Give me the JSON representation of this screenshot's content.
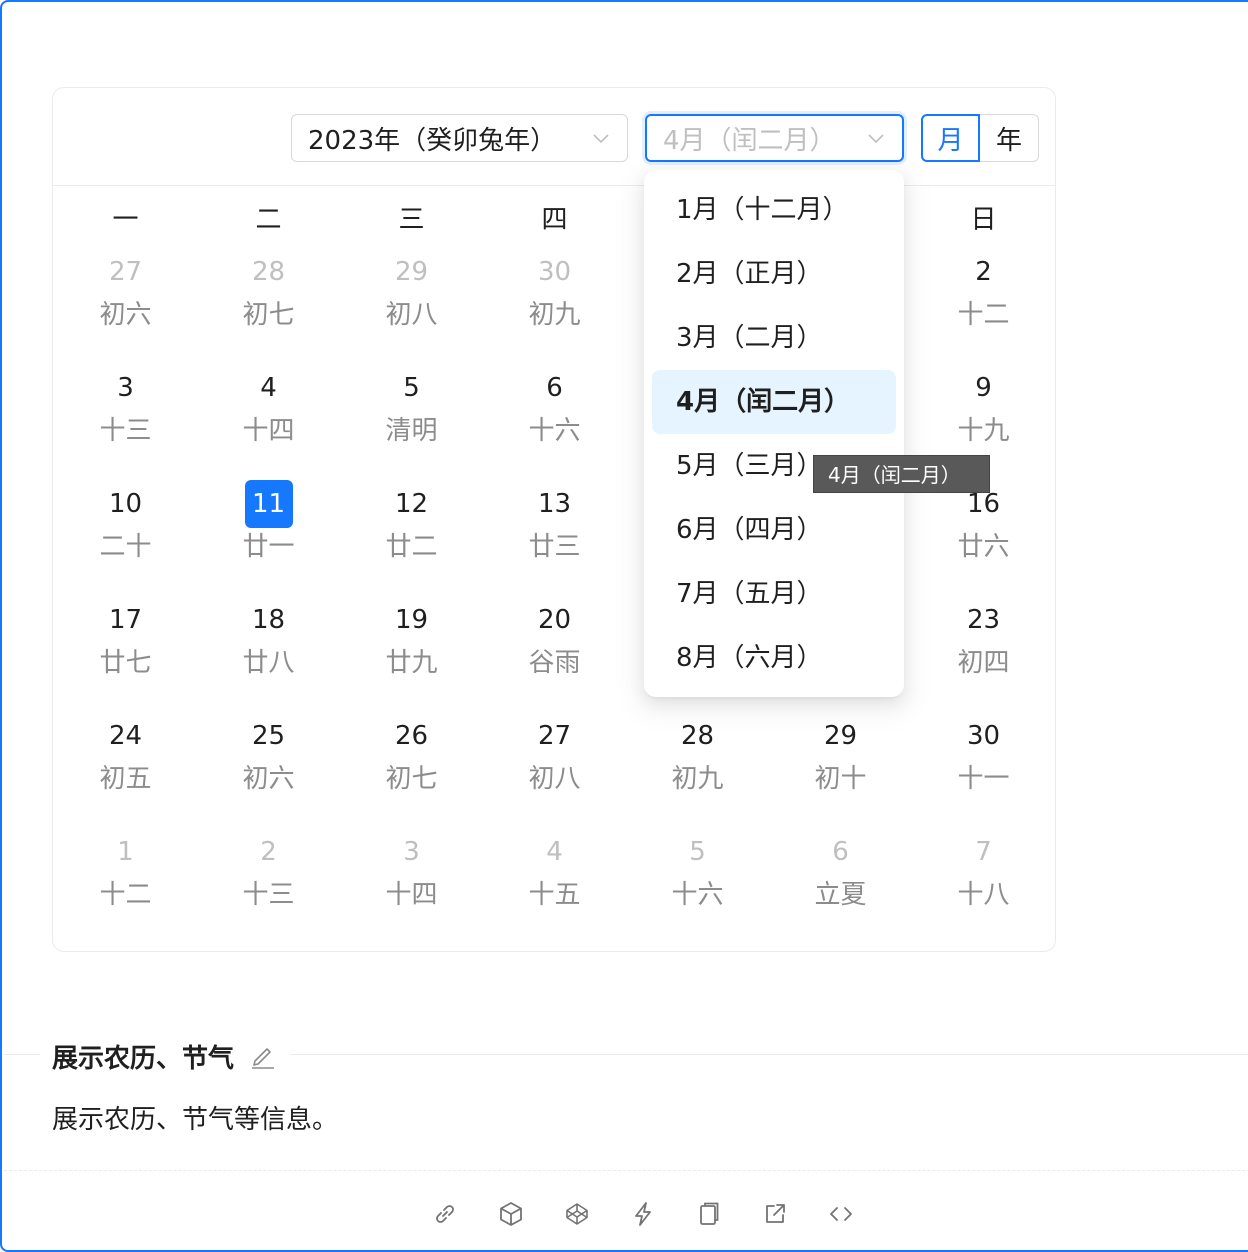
{
  "header": {
    "year_value": "2023年（癸卯兔年）",
    "month_value": "4月（闰二月）",
    "mode_month": "月",
    "mode_year": "年"
  },
  "weekdays": [
    "一",
    "二",
    "三",
    "四",
    "",
    "",
    "日"
  ],
  "days": [
    [
      {
        "n": "27",
        "l": "初六",
        "o": true
      },
      {
        "n": "28",
        "l": "初七",
        "o": true
      },
      {
        "n": "29",
        "l": "初八",
        "o": true
      },
      {
        "n": "30",
        "l": "初九",
        "o": true
      },
      {
        "n": "",
        "l": "",
        "o": true
      },
      {
        "n": "",
        "l": "",
        "o": true
      },
      {
        "n": "2",
        "l": "十二",
        "o": false
      }
    ],
    [
      {
        "n": "3",
        "l": "十三",
        "o": false
      },
      {
        "n": "4",
        "l": "十四",
        "o": false
      },
      {
        "n": "5",
        "l": "清明",
        "o": false
      },
      {
        "n": "6",
        "l": "十六",
        "o": false
      },
      {
        "n": "",
        "l": "",
        "o": false
      },
      {
        "n": "",
        "l": "",
        "o": false
      },
      {
        "n": "9",
        "l": "十九",
        "o": false
      }
    ],
    [
      {
        "n": "10",
        "l": "二十",
        "o": false
      },
      {
        "n": "11",
        "l": "廿一",
        "o": false,
        "today": true
      },
      {
        "n": "12",
        "l": "廿二",
        "o": false
      },
      {
        "n": "13",
        "l": "廿三",
        "o": false
      },
      {
        "n": "",
        "l": "",
        "o": false
      },
      {
        "n": "",
        "l": "",
        "o": false
      },
      {
        "n": "16",
        "l": "廿六",
        "o": false
      }
    ],
    [
      {
        "n": "17",
        "l": "廿七",
        "o": false
      },
      {
        "n": "18",
        "l": "廿八",
        "o": false
      },
      {
        "n": "19",
        "l": "廿九",
        "o": false
      },
      {
        "n": "20",
        "l": "谷雨",
        "o": false
      },
      {
        "n": "",
        "l": "",
        "o": false
      },
      {
        "n": "",
        "l": "",
        "o": false
      },
      {
        "n": "23",
        "l": "初四",
        "o": false
      }
    ],
    [
      {
        "n": "24",
        "l": "初五",
        "o": false
      },
      {
        "n": "25",
        "l": "初六",
        "o": false
      },
      {
        "n": "26",
        "l": "初七",
        "o": false
      },
      {
        "n": "27",
        "l": "初八",
        "o": false
      },
      {
        "n": "28",
        "l": "初九",
        "o": false
      },
      {
        "n": "29",
        "l": "初十",
        "o": false
      },
      {
        "n": "30",
        "l": "十一",
        "o": false
      }
    ],
    [
      {
        "n": "1",
        "l": "十二",
        "o": true
      },
      {
        "n": "2",
        "l": "十三",
        "o": true
      },
      {
        "n": "3",
        "l": "十四",
        "o": true
      },
      {
        "n": "4",
        "l": "十五",
        "o": true
      },
      {
        "n": "5",
        "l": "十六",
        "o": true
      },
      {
        "n": "6",
        "l": "立夏",
        "o": true
      },
      {
        "n": "7",
        "l": "十八",
        "o": true
      }
    ]
  ],
  "month_options": [
    {
      "label": "1月（十二月）",
      "selected": false
    },
    {
      "label": "2月（正月）",
      "selected": false
    },
    {
      "label": "3月（二月）",
      "selected": false
    },
    {
      "label": "4月（闰二月）",
      "selected": true
    },
    {
      "label": "5月（三月）",
      "selected": false
    },
    {
      "label": "6月（四月）",
      "selected": false
    },
    {
      "label": "7月（五月）",
      "selected": false
    },
    {
      "label": "8月（六月）",
      "selected": false
    }
  ],
  "tooltip": "4月（闰二月）",
  "section": {
    "title": "展示农历、节气",
    "description": "展示农历、节气等信息。"
  },
  "actions": [
    "link-icon",
    "codesandbox-icon",
    "codepen-icon",
    "stackblitz-icon",
    "copy-icon",
    "open-external-icon",
    "code-icon"
  ],
  "colors": {
    "accent": "#1677ff",
    "muted": "#bfbfbf",
    "lunar": "#8c8c8c",
    "selected_bg": "#e6f4ff"
  }
}
